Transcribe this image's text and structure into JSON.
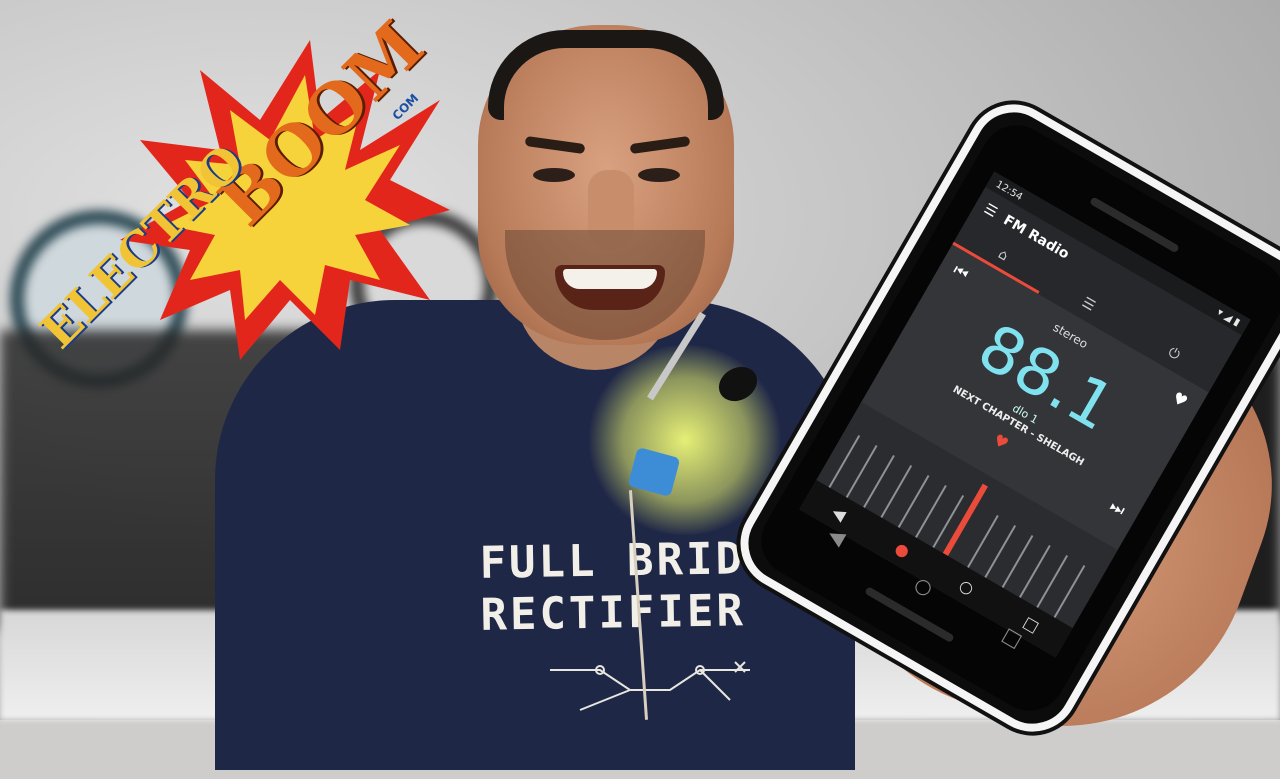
{
  "logo": {
    "boom": "BOOM",
    "electro": "ELECTRO",
    "com": "COM"
  },
  "shirt": {
    "line1": "FULL BRIDGE",
    "line2": "RECTIFIER"
  },
  "phone": {
    "status_time": "12:54",
    "app_title": "FM Radio",
    "stereo_label": "stereo",
    "frequency": "88.1",
    "station": "dlo 1",
    "rds_text": "NEXT CHAPTER - SHELAGH",
    "icons": {
      "menu": "menu-icon",
      "station": "radio-icon",
      "list": "list-icon",
      "power": "power-icon",
      "prev": "skip-previous-icon",
      "next": "skip-next-icon",
      "favorite": "heart-icon",
      "record": "record-icon",
      "back": "back-icon",
      "home": "home-icon",
      "recents": "recents-icon"
    }
  },
  "colors": {
    "accent": "#ea4b3b",
    "frequency": "#7fe2ee",
    "shirt": "#1f2747",
    "mic_highlight": "#f0fa78"
  }
}
